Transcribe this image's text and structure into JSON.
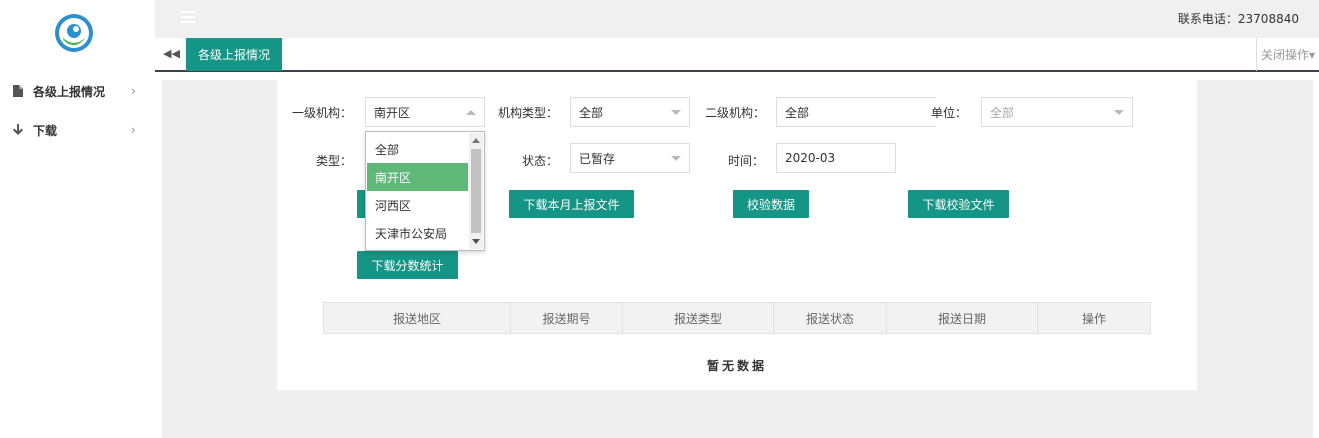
{
  "header": {
    "phone_label": "联系电话：23708840"
  },
  "sidebar": {
    "items": [
      {
        "label": "各级上报情况",
        "icon": "file-icon"
      },
      {
        "label": "下载",
        "icon": "arrow-down-icon"
      }
    ]
  },
  "tabs": {
    "active_label": "各级上报情况",
    "close_ops_label": "关闭操作▾"
  },
  "form": {
    "level1_label": "一级机构：",
    "level1_value": "南开区",
    "org_type_label": "机构类型：",
    "org_type_value": "全部",
    "level2_label": "二级机构：",
    "level2_value": "全部",
    "unit_label": "单位：",
    "unit_value": "全部",
    "type_label": "类型：",
    "status_label": "状态：",
    "status_value": "已暂存",
    "time_label": "时间：",
    "time_value": "2020-03"
  },
  "dropdown": {
    "options": [
      "全部",
      "南开区",
      "河西区",
      "天津市公安局"
    ],
    "selected_index": 1
  },
  "buttons": {
    "download_month": "下载本月上报文件",
    "verify_data": "校验数据",
    "download_verify": "下载校验文件",
    "download_score": "下载分数统计"
  },
  "table": {
    "columns": [
      "报送地区",
      "报送期号",
      "报送类型",
      "报送状态",
      "报送日期",
      "操作"
    ],
    "empty_text": "暂无数据"
  },
  "colors": {
    "accent": "#159585",
    "selected_option": "#5fb878"
  }
}
